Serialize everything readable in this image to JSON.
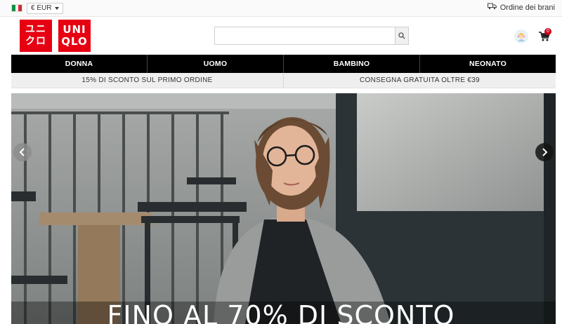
{
  "topbar": {
    "currency": "€ EUR",
    "orders_label": "Ordine dei brani"
  },
  "header": {
    "logo_jp_top": "ユニ",
    "logo_jp_bottom": "クロ",
    "logo_en_top": "UNI",
    "logo_en_bottom": "QLO",
    "search_placeholder": "",
    "cart_count": "0"
  },
  "nav": {
    "items": [
      "DONNA",
      "UOMO",
      "BAMBINO",
      "NEONATO"
    ]
  },
  "promo": {
    "left": "15% DI SCONTO SUL PRIMO ORDINE",
    "right": "CONSEGNA GRATUITA OLTRE €39"
  },
  "hero": {
    "headline": "FINO AL 70% DI SCONTO"
  },
  "colors": {
    "brand_red": "#e60012",
    "nav_black": "#000000",
    "promo_gray": "#efefef",
    "badge_red": "#d0021b"
  },
  "icons": {
    "flag": "italy-flag-icon",
    "caret": "caret-down-icon",
    "orders": "delivery-truck-icon",
    "search": "search-icon",
    "account": "account-avatar-icon",
    "cart": "cart-icon",
    "prev": "chevron-left-icon",
    "next": "chevron-right-icon"
  }
}
